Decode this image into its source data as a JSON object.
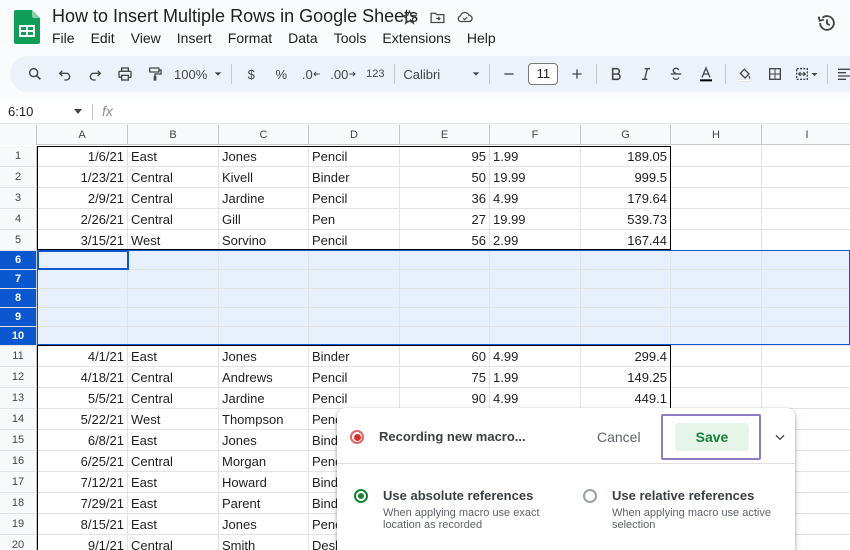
{
  "title_bar": {
    "doc_title": "How to Insert Multiple Rows in Google Sheets",
    "icons": [
      "star-icon",
      "move-folder-icon",
      "cloud-saved-icon"
    ],
    "history_icon": "version-history-icon"
  },
  "menu": [
    "File",
    "Edit",
    "View",
    "Insert",
    "Format",
    "Data",
    "Tools",
    "Extensions",
    "Help"
  ],
  "toolbar": {
    "zoom": "100%",
    "currency": "$",
    "percent": "%",
    "decrease_decimal": ".0",
    "increase_decimal": ".00",
    "number_format": "123",
    "font": "Calibri",
    "font_size": "11"
  },
  "formula_bar": {
    "name_box": "6:10",
    "fx": "fx"
  },
  "columns": [
    "A",
    "B",
    "C",
    "D",
    "E",
    "F",
    "G",
    "H",
    "I"
  ],
  "rows": [
    {
      "num": "1",
      "a": "1/6/21",
      "b": "East",
      "c": "Jones",
      "d": "Pencil",
      "e": "95",
      "f": "1.99",
      "g": "189.05"
    },
    {
      "num": "2",
      "a": "1/23/21",
      "b": "Central",
      "c": "Kivell",
      "d": "Binder",
      "e": "50",
      "f": "19.99",
      "g": "999.5"
    },
    {
      "num": "3",
      "a": "2/9/21",
      "b": "Central",
      "c": "Jardine",
      "d": "Pencil",
      "e": "36",
      "f": "4.99",
      "g": "179.64"
    },
    {
      "num": "4",
      "a": "2/26/21",
      "b": "Central",
      "c": "Gill",
      "d": "Pen",
      "e": "27",
      "f": "19.99",
      "g": "539.73"
    },
    {
      "num": "5",
      "a": "3/15/21",
      "b": "West",
      "c": "Sorvino",
      "d": "Pencil",
      "e": "56",
      "f": "2.99",
      "g": "167.44"
    },
    {
      "num": "6",
      "a": "",
      "b": "",
      "c": "",
      "d": "",
      "e": "",
      "f": "",
      "g": ""
    },
    {
      "num": "7",
      "a": "",
      "b": "",
      "c": "",
      "d": "",
      "e": "",
      "f": "",
      "g": ""
    },
    {
      "num": "8",
      "a": "",
      "b": "",
      "c": "",
      "d": "",
      "e": "",
      "f": "",
      "g": ""
    },
    {
      "num": "9",
      "a": "",
      "b": "",
      "c": "",
      "d": "",
      "e": "",
      "f": "",
      "g": ""
    },
    {
      "num": "10",
      "a": "",
      "b": "",
      "c": "",
      "d": "",
      "e": "",
      "f": "",
      "g": ""
    },
    {
      "num": "11",
      "a": "4/1/21",
      "b": "East",
      "c": "Jones",
      "d": "Binder",
      "e": "60",
      "f": "4.99",
      "g": "299.4"
    },
    {
      "num": "12",
      "a": "4/18/21",
      "b": "Central",
      "c": "Andrews",
      "d": "Pencil",
      "e": "75",
      "f": "1.99",
      "g": "149.25"
    },
    {
      "num": "13",
      "a": "5/5/21",
      "b": "Central",
      "c": "Jardine",
      "d": "Pencil",
      "e": "90",
      "f": "4.99",
      "g": "449.1"
    },
    {
      "num": "14",
      "a": "5/22/21",
      "b": "West",
      "c": "Thompson",
      "d": "Penc",
      "e": "",
      "f": "",
      "g": ""
    },
    {
      "num": "15",
      "a": "6/8/21",
      "b": "East",
      "c": "Jones",
      "d": "Bind",
      "e": "",
      "f": "",
      "g": ""
    },
    {
      "num": "16",
      "a": "6/25/21",
      "b": "Central",
      "c": "Morgan",
      "d": "Penc",
      "e": "",
      "f": "",
      "g": ""
    },
    {
      "num": "17",
      "a": "7/12/21",
      "b": "East",
      "c": "Howard",
      "d": "Bind",
      "e": "",
      "f": "",
      "g": ""
    },
    {
      "num": "18",
      "a": "7/29/21",
      "b": "East",
      "c": "Parent",
      "d": "Bind",
      "e": "",
      "f": "",
      "g": ""
    },
    {
      "num": "19",
      "a": "8/15/21",
      "b": "East",
      "c": "Jones",
      "d": "Penc",
      "e": "",
      "f": "",
      "g": ""
    },
    {
      "num": "20",
      "a": "9/1/21",
      "b": "Central",
      "c": "Smith",
      "d": "Desk",
      "e": "",
      "f": "",
      "g": ""
    }
  ],
  "selected_rows": [
    "6",
    "7",
    "8",
    "9",
    "10"
  ],
  "macro_dialog": {
    "status": "Recording new macro...",
    "cancel": "Cancel",
    "save": "Save",
    "absolute_title": "Use absolute references",
    "absolute_desc": "When applying macro use exact location as recorded",
    "relative_title": "Use relative references",
    "relative_desc": "When applying macro use active selection",
    "selected_option": "absolute"
  },
  "colors": {
    "accent": "#0b57d0",
    "selection_fill": "#e8f0fe",
    "save_green": "#188038",
    "record_red": "#d93025",
    "highlight_frame": "#8e7cc3"
  }
}
